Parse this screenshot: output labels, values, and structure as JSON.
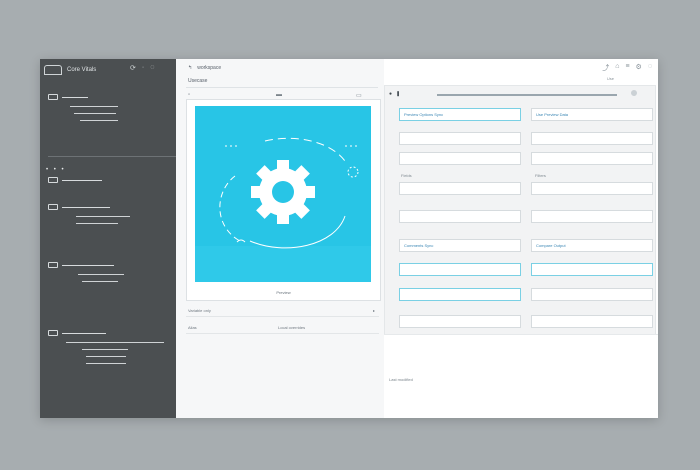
{
  "sidebar": {
    "title": "Core Vitals",
    "top_icons": [
      "refresh-icon",
      "dot-icon",
      "help-icon"
    ],
    "dots": "• • •"
  },
  "middle": {
    "header_title": "workspace",
    "sub_title": "Usecase",
    "card_caption": "Preview",
    "field1_label": "Variable only",
    "field2_label": "Alias",
    "field2_value": "Local overrides"
  },
  "right": {
    "top_icons": [
      "share-icon",
      "tag-icon",
      "list-icon",
      "gear-icon",
      "help-icon"
    ],
    "top_sub": "Use",
    "rows": [
      {
        "left": "Preview Options Sync",
        "right": "Use Preview Data"
      },
      {
        "left": "",
        "right": ""
      },
      {
        "left": "",
        "right": ""
      },
      {
        "left": "",
        "right": ""
      },
      {
        "left": "",
        "right": ""
      },
      {
        "left": "Comments Sync",
        "right": "Compare Output"
      },
      {
        "left": "",
        "right": ""
      },
      {
        "left": "",
        "right": ""
      },
      {
        "left": "",
        "right": ""
      }
    ],
    "mid_labels": {
      "left": "Fields",
      "right": "Filters"
    },
    "footer_text": "Last modified"
  },
  "colors": {
    "sidebar_bg": "#4b4f51",
    "hero_bg": "#28c5e6",
    "accent": "#7ad0e4",
    "page_bg": "#a7adb0"
  }
}
